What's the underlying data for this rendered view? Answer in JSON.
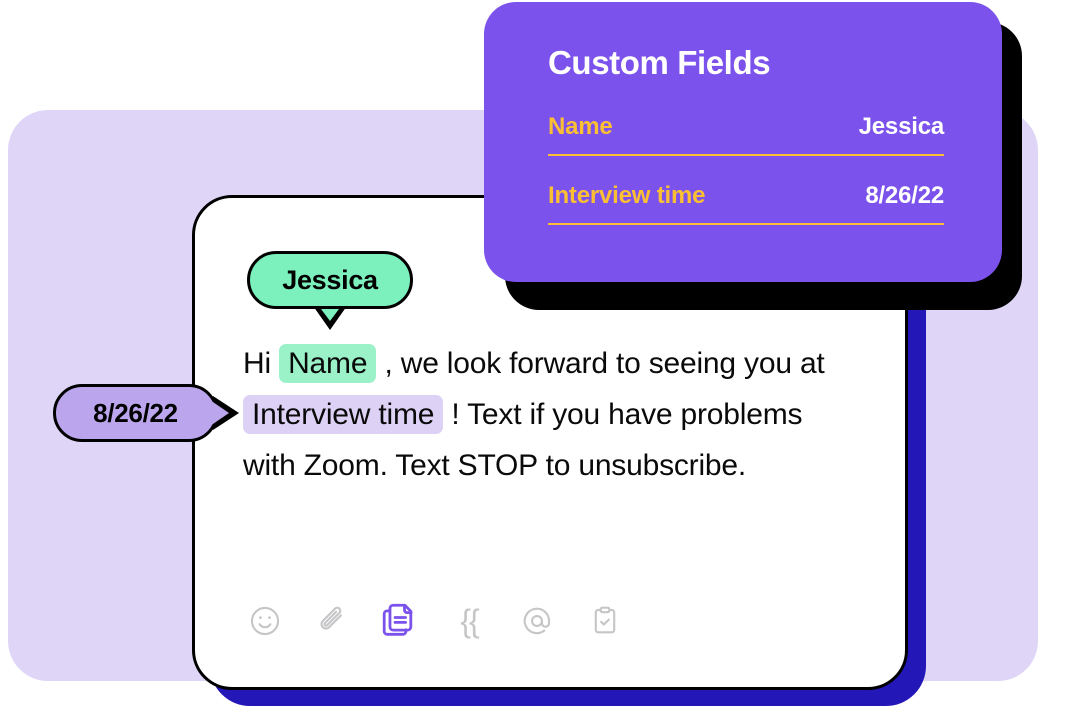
{
  "custom_fields_card": {
    "title": "Custom Fields",
    "rows": [
      {
        "key": "Name",
        "value": "Jessica"
      },
      {
        "key": "Interview time",
        "value": "8/26/22"
      }
    ],
    "accent_color": "#FBBF33",
    "background_color": "#7B52EC",
    "value_color": "#FFFFFF"
  },
  "message_card": {
    "sender_bubble": {
      "label": "Jessica",
      "color": "#7CF0BD"
    },
    "date_pill": {
      "label": "8/26/22",
      "color": "#BBA5ED"
    },
    "body": {
      "line1": {
        "prefix": "Hi",
        "token": "Name",
        "suffix": ", we look forward to seeing you at"
      },
      "line2": {
        "token": "Interview time",
        "suffix": "! Text if you have problems"
      },
      "line3": {
        "text": "with Zoom. Text STOP to unsubscribe."
      }
    },
    "token_colors": {
      "name": "#9BF2C8",
      "interview_time": "#DDD2F6"
    },
    "shadow_color": "#2417B8"
  },
  "toolbar": {
    "items": [
      {
        "name": "emoji-icon",
        "label": "Emoji",
        "active": false
      },
      {
        "name": "attachment-icon",
        "label": "Attachment",
        "active": false
      },
      {
        "name": "templates-icon",
        "label": "Templates",
        "active": true
      },
      {
        "name": "merge-field-icon",
        "label": "{{",
        "active": false
      },
      {
        "name": "mention-icon",
        "label": "Mention",
        "active": false
      },
      {
        "name": "task-icon",
        "label": "Task",
        "active": false
      }
    ],
    "active_color": "#7B52EC",
    "inactive_color": "#C6C6C8"
  },
  "background": {
    "panel_color": "#DFD6F7"
  }
}
